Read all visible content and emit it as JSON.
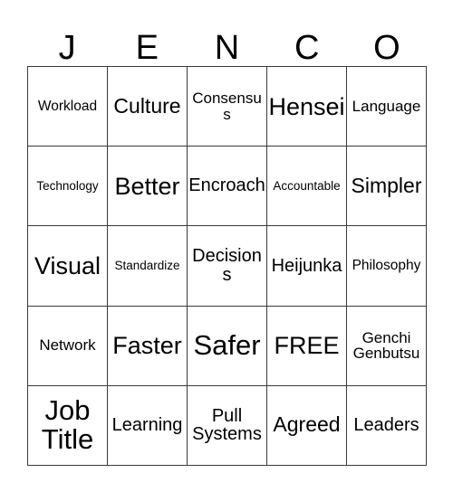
{
  "card": {
    "title_letters": [
      "J",
      "E",
      "N",
      "C",
      "O"
    ],
    "free_space": "FREE",
    "colors": {
      "background": "#ffffff",
      "text": "#000000",
      "gridline": "#3a3a3a"
    },
    "rows": [
      [
        {
          "label": "Workload",
          "size": "s"
        },
        {
          "label": "Culture",
          "size": "xl"
        },
        {
          "label": "Consensus",
          "size": "m"
        },
        {
          "label": "Hensei",
          "size": "xxl"
        },
        {
          "label": "Language",
          "size": "m"
        }
      ],
      [
        {
          "label": "Technology",
          "size": "xs"
        },
        {
          "label": "Better",
          "size": "xxl"
        },
        {
          "label": "Encroach",
          "size": "l"
        },
        {
          "label": "Accountable",
          "size": "xs"
        },
        {
          "label": "Simpler",
          "size": "xl"
        }
      ],
      [
        {
          "label": "Visual",
          "size": "xxl"
        },
        {
          "label": "Standardize",
          "size": "xs"
        },
        {
          "label": "Decisions",
          "size": "l"
        },
        {
          "label": "Heijunka",
          "size": "l"
        },
        {
          "label": "Philosophy",
          "size": "s"
        }
      ],
      [
        {
          "label": "Network",
          "size": "m"
        },
        {
          "label": "Faster",
          "size": "xxl"
        },
        {
          "label": "Safer",
          "size": "huge"
        },
        {
          "label": "FREE",
          "size": "xxl"
        },
        {
          "label": "Genchi\nGenbutsu",
          "size": "m"
        }
      ],
      [
        {
          "label": "Job\nTitle",
          "size": "huge"
        },
        {
          "label": "Learning",
          "size": "l"
        },
        {
          "label": "Pull\nSystems",
          "size": "l"
        },
        {
          "label": "Agreed",
          "size": "xl"
        },
        {
          "label": "Leaders",
          "size": "l"
        }
      ]
    ]
  }
}
